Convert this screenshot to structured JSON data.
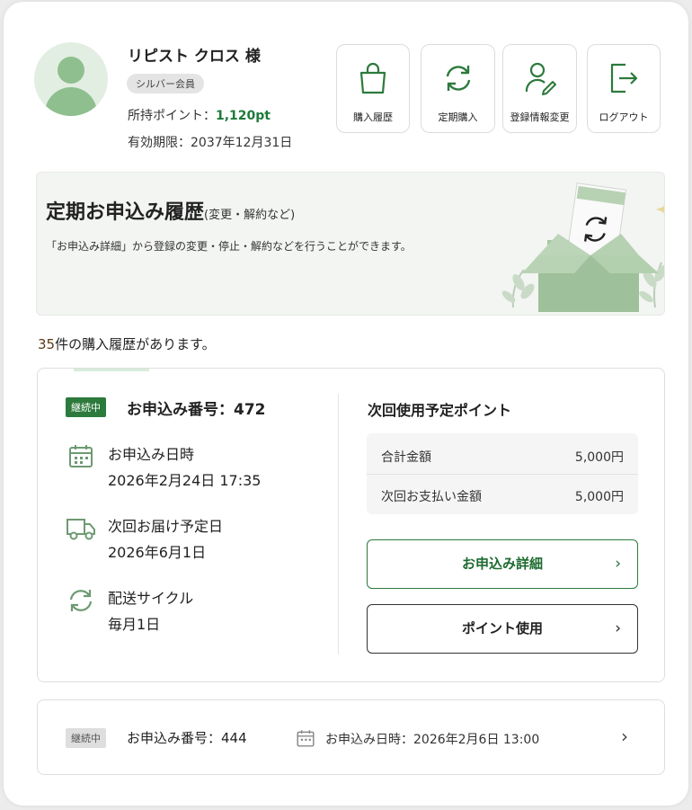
{
  "user": {
    "name": "リピスト クロス 様",
    "rank": "シルバー会員",
    "points_label": "所持ポイント：",
    "points_value": "1,120pt",
    "expiry": "有効期限：2037年12月31日"
  },
  "nav": [
    {
      "label": "購入履歴",
      "icon": "shopping-bag-icon"
    },
    {
      "label": "定期購入",
      "icon": "refresh-cycle-icon"
    },
    {
      "label": "登録情報変更",
      "icon": "user-edit-icon"
    },
    {
      "label": "ログアウト",
      "icon": "logout-icon"
    }
  ],
  "banner": {
    "title": "定期お申込み履歴",
    "subtitle": "(変更・解約など)",
    "description": "「お申込み詳細」から登録の変更・停止・解約などを行うことができます。"
  },
  "history": {
    "count": "35",
    "count_text": "件の購入履歴があります。"
  },
  "order1": {
    "status": "継続中",
    "number": "お申込み番号：472",
    "date_label": "お申込み日時",
    "date_value": "2026年2月24日 17:35",
    "delivery_label": "次回お届け予定日",
    "delivery_value": "2026年6月1日",
    "cycle_label": "配送サイクル",
    "cycle_value": "毎月1日",
    "points_title": "次回使用予定ポイント",
    "total_label": "合計金額",
    "total_value": "5,000円",
    "payment_label": "次回お支払い金額",
    "payment_value": "5,000円",
    "detail_button": "お申込み詳細",
    "points_button": "ポイント使用"
  },
  "order2": {
    "status": "継続中",
    "number": "お申込み番号：444",
    "date": "お申込み日時：2026年2月6日 13:00"
  },
  "colors": {
    "accent_green": "#2c7a3c",
    "points_green": "#1e7a3a",
    "banner_bg": "#f3f5f2"
  }
}
